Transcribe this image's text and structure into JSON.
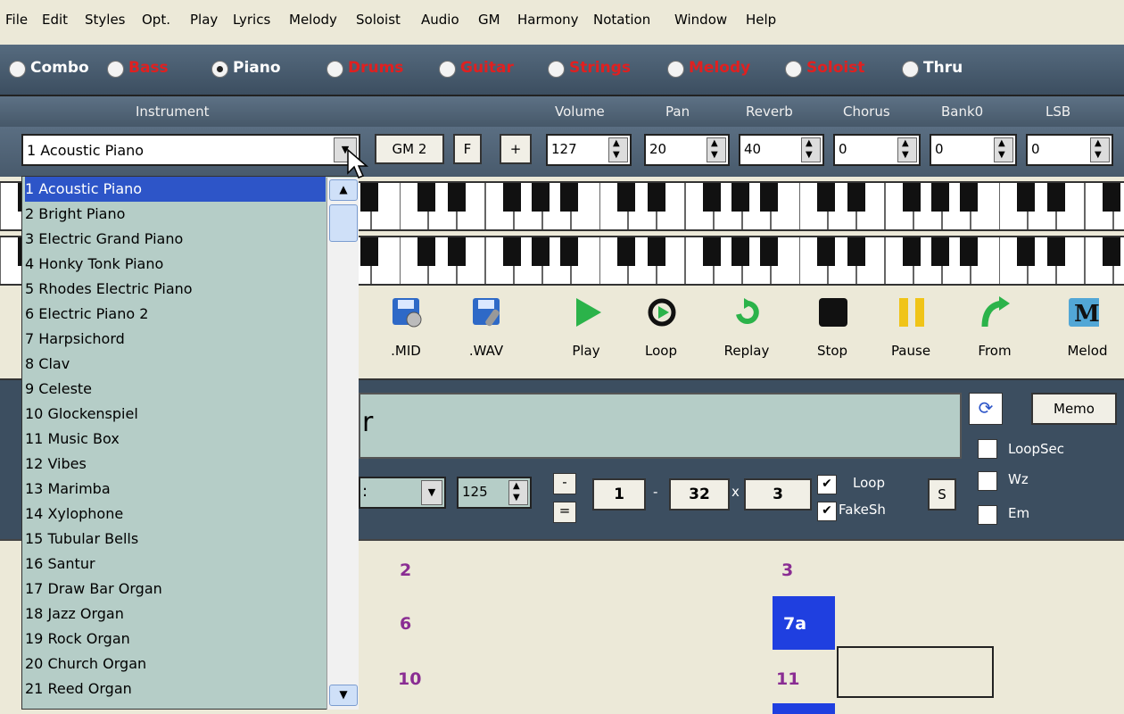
{
  "menu": [
    "File",
    "Edit",
    "Styles",
    "Opt.",
    "Play",
    "Lyrics",
    "Melody",
    "Soloist",
    "Audio",
    "GM",
    "Harmony",
    "Notation",
    "Window",
    "Help"
  ],
  "parts": [
    {
      "label": "Combo",
      "color": "#ffffff",
      "selected": false
    },
    {
      "label": "Bass",
      "color": "#e02020",
      "selected": false
    },
    {
      "label": "Piano",
      "color": "#ffffff",
      "selected": true
    },
    {
      "label": "Drums",
      "color": "#e02020",
      "selected": false
    },
    {
      "label": "Guitar",
      "color": "#e02020",
      "selected": false
    },
    {
      "label": "Strings",
      "color": "#e02020",
      "selected": false
    },
    {
      "label": "Melody",
      "color": "#e02020",
      "selected": false
    },
    {
      "label": "Soloist",
      "color": "#e02020",
      "selected": false
    },
    {
      "label": "Thru",
      "color": "#ffffff",
      "selected": false
    }
  ],
  "mixer": {
    "instrument_label": "Instrument",
    "instrument_value": "1 Acoustic Piano",
    "gm2_label": "GM 2",
    "f_label": "F",
    "plus_label": "+",
    "headers": [
      "Volume",
      "Pan",
      "Reverb",
      "Chorus",
      "Bank0",
      "LSB"
    ],
    "values": [
      "127",
      "20",
      "40",
      "0",
      "0",
      "0"
    ]
  },
  "instruments": [
    "1 Acoustic Piano",
    "2 Bright Piano",
    "3 Electric Grand Piano",
    "4 Honky Tonk Piano",
    "5 Rhodes Electric Piano",
    "6 Electric Piano 2",
    "7 Harpsichord",
    "8 Clav",
    "9 Celeste",
    "10 Glockenspiel",
    "11 Music Box",
    "12 Vibes",
    "13 Marimba",
    "14 Xylophone",
    "15 Tubular Bells",
    "16 Santur",
    "17 Draw Bar Organ",
    "18 Jazz Organ",
    "19 Rock Organ",
    "20 Church Organ",
    "21 Reed Organ"
  ],
  "toolbar": [
    ".MID",
    ".WAV",
    "Play",
    "Loop",
    "Replay",
    "Stop",
    "Pause",
    "From",
    "Melod"
  ],
  "song": {
    "title_fragment": "r",
    "memo_label": "Memo",
    "tempo": "125",
    "minus_label": "-",
    "equal_label": "=",
    "start": "1",
    "dash": "-",
    "end": "32",
    "x_label": "x",
    "repeats": "3",
    "loop_label": "Loop",
    "fakesh_label": "FakeSh",
    "s_label": "S",
    "loopsec_label": "LoopSec",
    "wz_label": "Wz",
    "em_label": "Em",
    "style_fragment": ":"
  },
  "grid": {
    "bars": [
      "2",
      "3",
      "6",
      "7a",
      "10",
      "11"
    ]
  },
  "colors": {
    "accent": "#2d55c8",
    "panel": "#3c4e60",
    "list_bg": "#b5cdc7",
    "bar_number": "#8a2d93"
  }
}
